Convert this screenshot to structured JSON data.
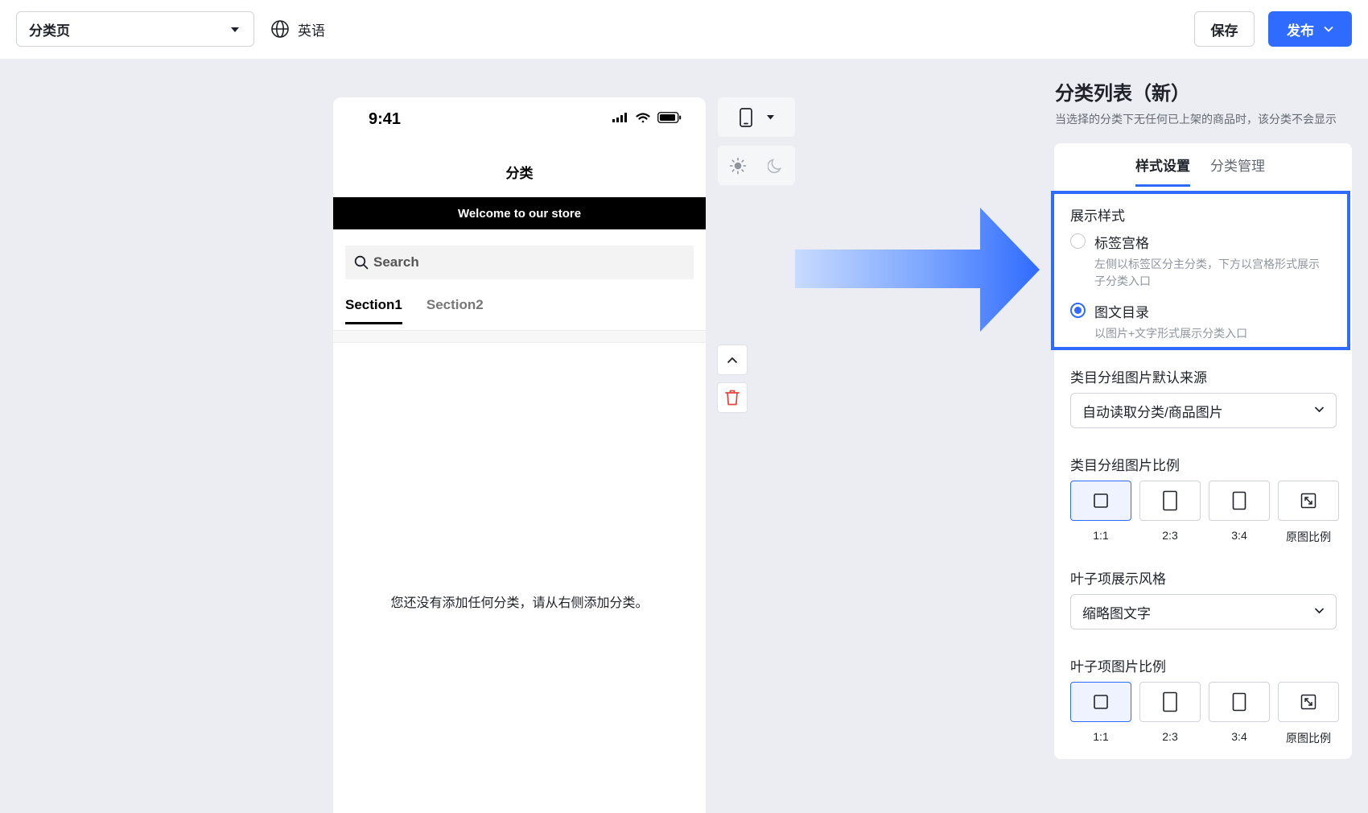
{
  "topbar": {
    "page_select": "分类页",
    "language": "英语",
    "save_label": "保存",
    "publish_label": "发布"
  },
  "phone": {
    "time": "9:41",
    "title": "分类",
    "banner": "Welcome to our store",
    "search_placeholder": "Search",
    "tabs": [
      {
        "label": "Section1",
        "active": true
      },
      {
        "label": "Section2",
        "active": false
      }
    ],
    "empty_message": "您还没有添加任何分类，请从右侧添加分类。"
  },
  "tools": {
    "device_icon": "mobile-phone-icon",
    "theme_icons": [
      "sun-icon",
      "moon-icon"
    ],
    "up_icon": "chevron-up-icon",
    "delete_icon": "trash-icon"
  },
  "panel": {
    "title": "分类列表（新）",
    "subtitle": "当选择的分类下无任何已上架的商品时，该分类不会显示",
    "tabs": [
      {
        "label": "样式设置",
        "active": true
      },
      {
        "label": "分类管理",
        "active": false
      }
    ],
    "display_style": {
      "label": "展示样式",
      "options": [
        {
          "title": "标签宫格",
          "desc": "左侧以标签区分主分类，下方以宫格形式展示子分类入口",
          "checked": false
        },
        {
          "title": "图文目录",
          "desc": "以图片+文字形式展示分类入口",
          "checked": true
        }
      ]
    },
    "image_source": {
      "label": "类目分组图片默认来源",
      "value": "自动读取分类/商品图片"
    },
    "group_ratio": {
      "label": "类目分组图片比例",
      "options": [
        "1:1",
        "2:3",
        "3:4",
        "原图比例"
      ],
      "selected": "1:1"
    },
    "leaf_style": {
      "label": "叶子项展示风格",
      "value": "缩略图文字"
    },
    "leaf_ratio": {
      "label": "叶子项图片比例",
      "options": [
        "1:1",
        "2:3",
        "3:4",
        "原图比例"
      ],
      "selected": "1:1"
    }
  },
  "colors": {
    "accent": "#2f6bff",
    "background": "#ebedf2",
    "banner": "#000000"
  }
}
